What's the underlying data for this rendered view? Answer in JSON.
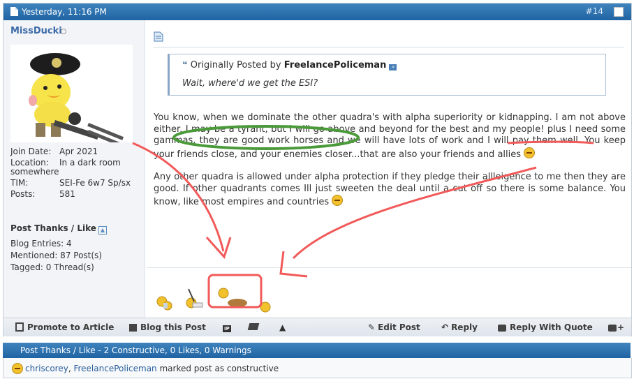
{
  "post": {
    "date": "Yesterday, 11:16 PM",
    "number": "#14"
  },
  "user": {
    "name": "MissDucki",
    "stats": [
      {
        "label": "Join Date:",
        "value": "Apr 2021"
      },
      {
        "label": "Location:",
        "value": "In a dark room"
      },
      {
        "label": "",
        "value": "somewhere"
      },
      {
        "label": "TIM:",
        "value": "SEI-Fe 6w7 Sp/sx"
      },
      {
        "label": "Posts:",
        "value": "581"
      }
    ],
    "thanks_heading": "Post Thanks / Like",
    "substats": [
      "Blog Entries:   4",
      "Mentioned:   87 Post(s)",
      "Tagged:   0 Thread(s)"
    ]
  },
  "quote": {
    "prefix": "Originally Posted by",
    "author": "FreelancePoliceman",
    "text": "Wait, where'd we get the ESI?"
  },
  "message": {
    "p1": "You know, when we dominate the other quadra's with alpha superiority or kidnapping. I am not above either. I may be a tyrant, but I will go above and beyond for the best and my people! plus I need some gammas, they are good work horses and we will have lots of work and I will pay them well. You keep your friends close, and your enemies closer...that are also your friends and allies",
    "p2": "Any other quadra is allowed under alpha protection if they pledge their allleigence to me then they are good. If other quadrants comes Ill just sweeten the deal until a cut off so there is some balance. You know, like most empires and countries"
  },
  "actions": {
    "promote": "Promote to Article",
    "blog": "Blog this Post",
    "edit": "Edit Post",
    "reply": "Reply",
    "reply_quote": "Reply With Quote"
  },
  "thanks_bar": {
    "title": "Post Thanks / Like - 2 Constructive, 0 Likes, 0 Warnings",
    "user1": "chriscorey",
    "sep": ", ",
    "user2": "FreelancePoliceman",
    "suffix": " marked post as constructive"
  },
  "colors": {
    "header_blue": "#2a6eab",
    "annotation_red": "#f25a5a",
    "annotation_green": "#4a9a3a"
  }
}
